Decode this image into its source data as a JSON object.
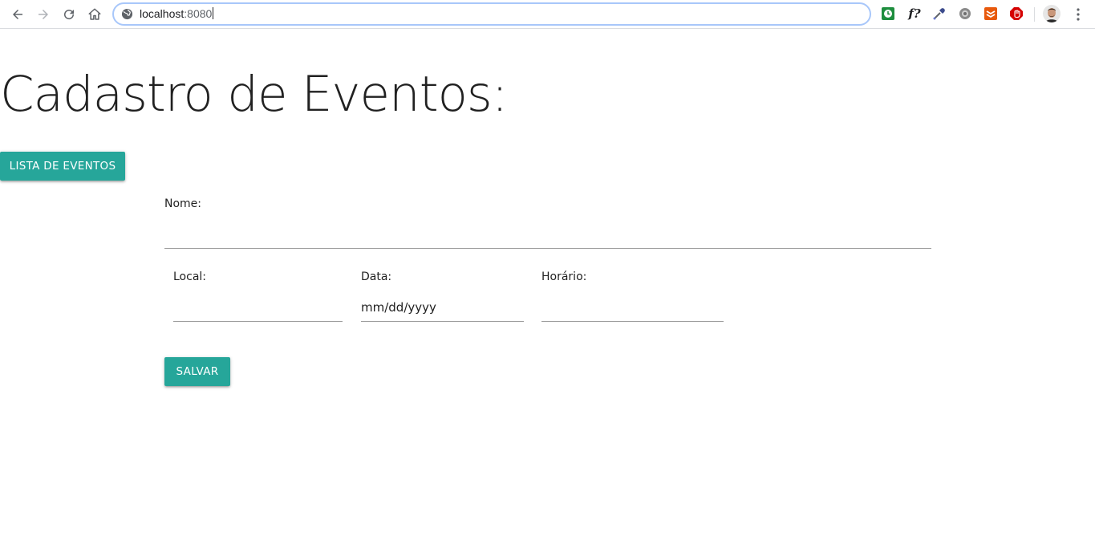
{
  "browser": {
    "url_host": "localhost",
    "url_port": ":8080",
    "extensions": [
      "clock-extension-icon",
      "font-finder-icon",
      "color-picker-icon",
      "settings-gear-icon",
      "shield-extension-icon",
      "adblock-icon"
    ],
    "colors": {
      "omnibox_border": "#a8c7fa",
      "text": "#202124"
    }
  },
  "page": {
    "title": "Cadastro de Eventos:",
    "list_button_label": "Lista de eventos",
    "save_button_label": "Salvar",
    "accent_color": "#26a69a"
  },
  "form": {
    "nome": {
      "label": "Nome:",
      "value": ""
    },
    "local": {
      "label": "Local:",
      "value": ""
    },
    "data": {
      "label": "Data:",
      "placeholder": "mm/dd/yyyy"
    },
    "horario": {
      "label": "Horário:",
      "value": ""
    }
  }
}
